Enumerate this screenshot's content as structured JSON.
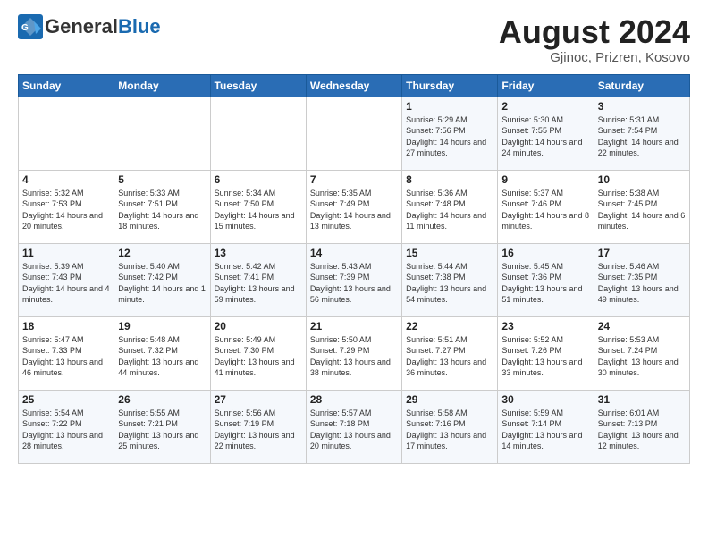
{
  "header": {
    "logo_general": "General",
    "logo_blue": "Blue",
    "month_year": "August 2024",
    "location": "Gjinoc, Prizren, Kosovo"
  },
  "days_of_week": [
    "Sunday",
    "Monday",
    "Tuesday",
    "Wednesday",
    "Thursday",
    "Friday",
    "Saturday"
  ],
  "weeks": [
    [
      {
        "day": "",
        "info": ""
      },
      {
        "day": "",
        "info": ""
      },
      {
        "day": "",
        "info": ""
      },
      {
        "day": "",
        "info": ""
      },
      {
        "day": "1",
        "info": "Sunrise: 5:29 AM\nSunset: 7:56 PM\nDaylight: 14 hours and 27 minutes."
      },
      {
        "day": "2",
        "info": "Sunrise: 5:30 AM\nSunset: 7:55 PM\nDaylight: 14 hours and 24 minutes."
      },
      {
        "day": "3",
        "info": "Sunrise: 5:31 AM\nSunset: 7:54 PM\nDaylight: 14 hours and 22 minutes."
      }
    ],
    [
      {
        "day": "4",
        "info": "Sunrise: 5:32 AM\nSunset: 7:53 PM\nDaylight: 14 hours and 20 minutes."
      },
      {
        "day": "5",
        "info": "Sunrise: 5:33 AM\nSunset: 7:51 PM\nDaylight: 14 hours and 18 minutes."
      },
      {
        "day": "6",
        "info": "Sunrise: 5:34 AM\nSunset: 7:50 PM\nDaylight: 14 hours and 15 minutes."
      },
      {
        "day": "7",
        "info": "Sunrise: 5:35 AM\nSunset: 7:49 PM\nDaylight: 14 hours and 13 minutes."
      },
      {
        "day": "8",
        "info": "Sunrise: 5:36 AM\nSunset: 7:48 PM\nDaylight: 14 hours and 11 minutes."
      },
      {
        "day": "9",
        "info": "Sunrise: 5:37 AM\nSunset: 7:46 PM\nDaylight: 14 hours and 8 minutes."
      },
      {
        "day": "10",
        "info": "Sunrise: 5:38 AM\nSunset: 7:45 PM\nDaylight: 14 hours and 6 minutes."
      }
    ],
    [
      {
        "day": "11",
        "info": "Sunrise: 5:39 AM\nSunset: 7:43 PM\nDaylight: 14 hours and 4 minutes."
      },
      {
        "day": "12",
        "info": "Sunrise: 5:40 AM\nSunset: 7:42 PM\nDaylight: 14 hours and 1 minute."
      },
      {
        "day": "13",
        "info": "Sunrise: 5:42 AM\nSunset: 7:41 PM\nDaylight: 13 hours and 59 minutes."
      },
      {
        "day": "14",
        "info": "Sunrise: 5:43 AM\nSunset: 7:39 PM\nDaylight: 13 hours and 56 minutes."
      },
      {
        "day": "15",
        "info": "Sunrise: 5:44 AM\nSunset: 7:38 PM\nDaylight: 13 hours and 54 minutes."
      },
      {
        "day": "16",
        "info": "Sunrise: 5:45 AM\nSunset: 7:36 PM\nDaylight: 13 hours and 51 minutes."
      },
      {
        "day": "17",
        "info": "Sunrise: 5:46 AM\nSunset: 7:35 PM\nDaylight: 13 hours and 49 minutes."
      }
    ],
    [
      {
        "day": "18",
        "info": "Sunrise: 5:47 AM\nSunset: 7:33 PM\nDaylight: 13 hours and 46 minutes."
      },
      {
        "day": "19",
        "info": "Sunrise: 5:48 AM\nSunset: 7:32 PM\nDaylight: 13 hours and 44 minutes."
      },
      {
        "day": "20",
        "info": "Sunrise: 5:49 AM\nSunset: 7:30 PM\nDaylight: 13 hours and 41 minutes."
      },
      {
        "day": "21",
        "info": "Sunrise: 5:50 AM\nSunset: 7:29 PM\nDaylight: 13 hours and 38 minutes."
      },
      {
        "day": "22",
        "info": "Sunrise: 5:51 AM\nSunset: 7:27 PM\nDaylight: 13 hours and 36 minutes."
      },
      {
        "day": "23",
        "info": "Sunrise: 5:52 AM\nSunset: 7:26 PM\nDaylight: 13 hours and 33 minutes."
      },
      {
        "day": "24",
        "info": "Sunrise: 5:53 AM\nSunset: 7:24 PM\nDaylight: 13 hours and 30 minutes."
      }
    ],
    [
      {
        "day": "25",
        "info": "Sunrise: 5:54 AM\nSunset: 7:22 PM\nDaylight: 13 hours and 28 minutes."
      },
      {
        "day": "26",
        "info": "Sunrise: 5:55 AM\nSunset: 7:21 PM\nDaylight: 13 hours and 25 minutes."
      },
      {
        "day": "27",
        "info": "Sunrise: 5:56 AM\nSunset: 7:19 PM\nDaylight: 13 hours and 22 minutes."
      },
      {
        "day": "28",
        "info": "Sunrise: 5:57 AM\nSunset: 7:18 PM\nDaylight: 13 hours and 20 minutes."
      },
      {
        "day": "29",
        "info": "Sunrise: 5:58 AM\nSunset: 7:16 PM\nDaylight: 13 hours and 17 minutes."
      },
      {
        "day": "30",
        "info": "Sunrise: 5:59 AM\nSunset: 7:14 PM\nDaylight: 13 hours and 14 minutes."
      },
      {
        "day": "31",
        "info": "Sunrise: 6:01 AM\nSunset: 7:13 PM\nDaylight: 13 hours and 12 minutes."
      }
    ]
  ]
}
